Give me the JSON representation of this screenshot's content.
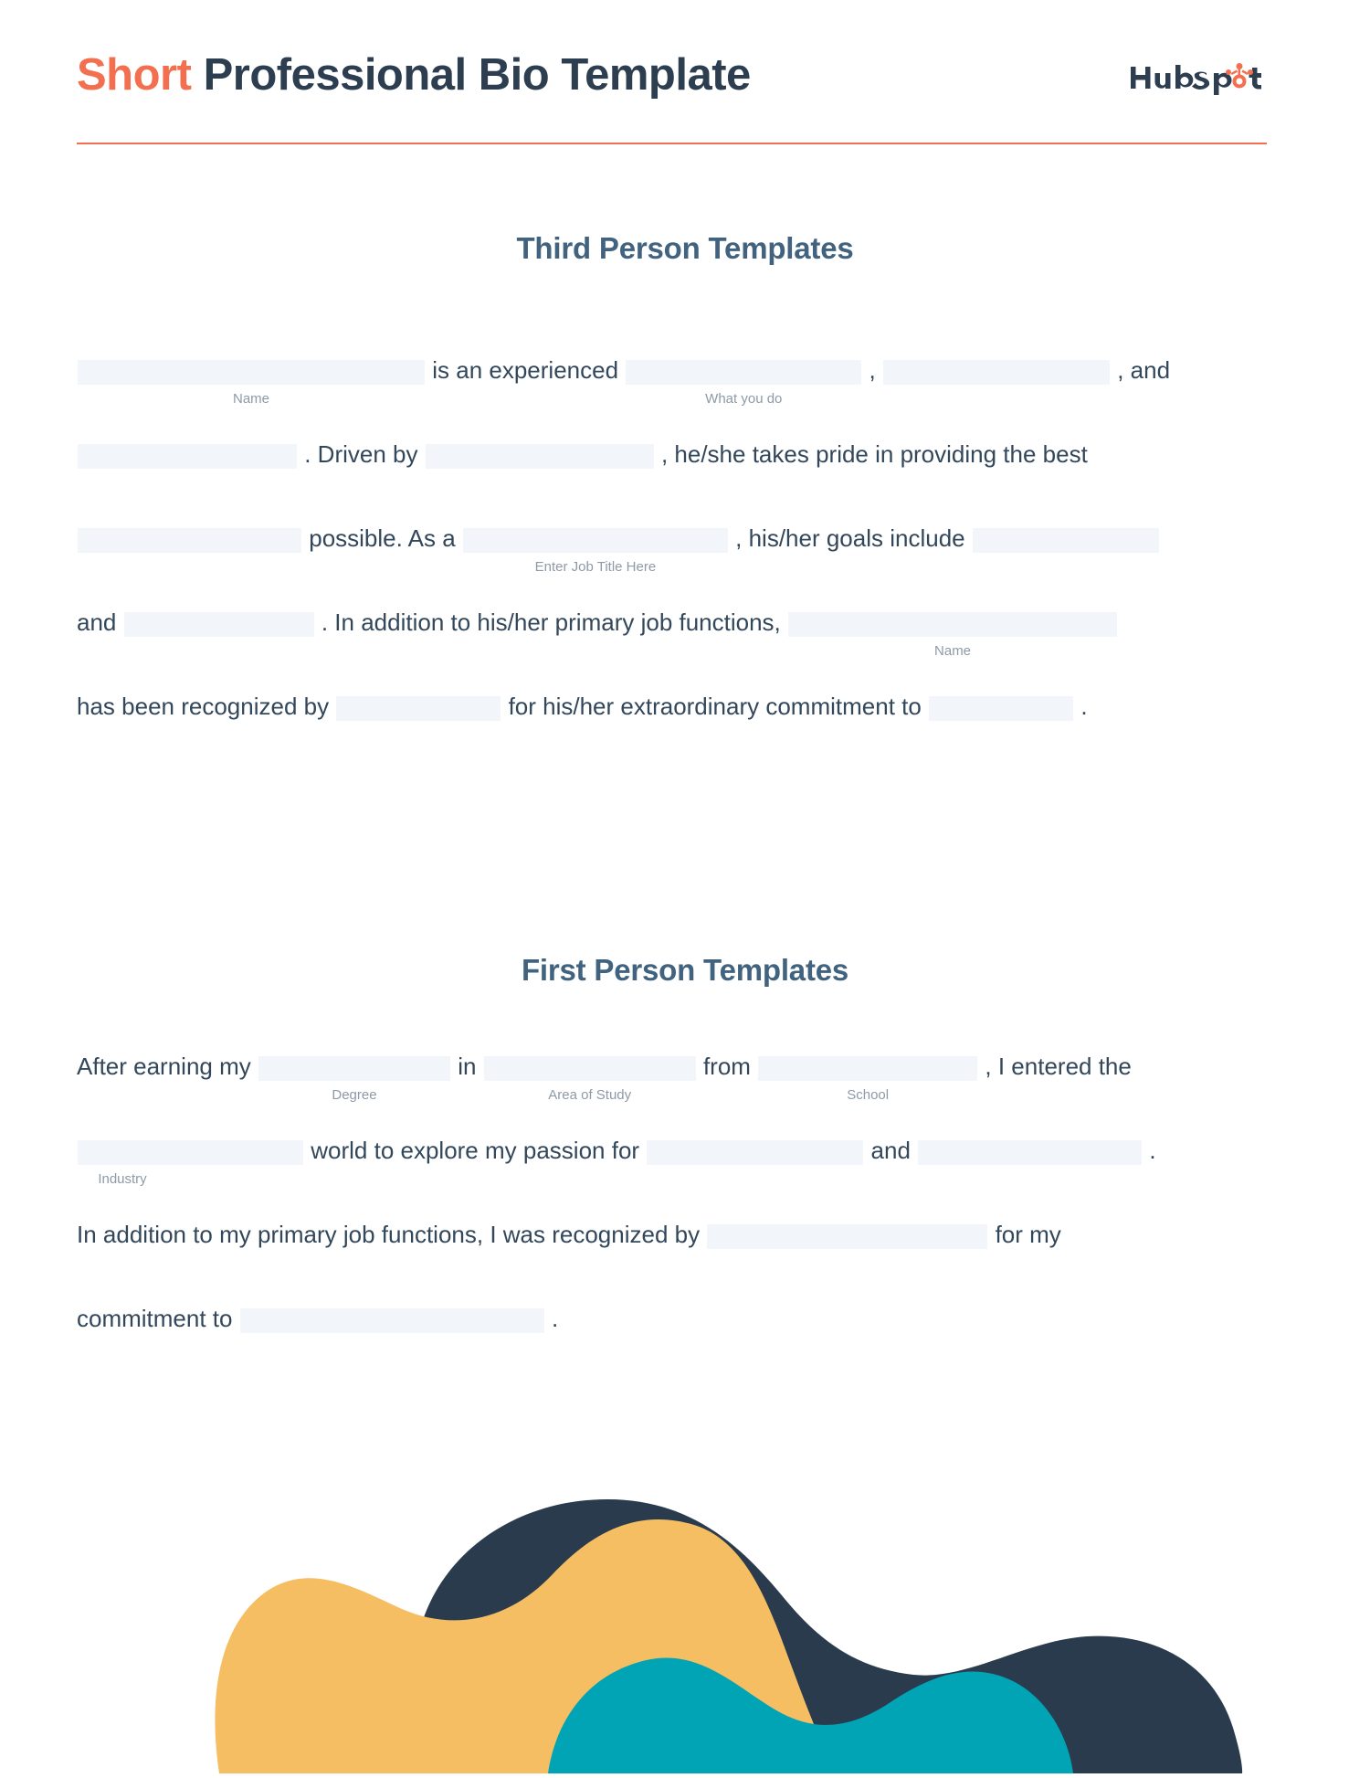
{
  "document": {
    "title_accent": "Short",
    "title_rest": "Professional Bio Template",
    "brand_logo_name": "HubSpot",
    "colors": {
      "accent_orange": "#f2704f",
      "navy": "#2d3e50",
      "heading_blue": "#41637f",
      "body_text": "#33475b",
      "blank_fill": "#f2f5f9",
      "label_gray": "#8d9aa8",
      "blob_navy": "#2a3b4d",
      "blob_yellow": "#f5be63",
      "blob_teal": "#00a4b4"
    }
  },
  "sections": [
    {
      "id": "third",
      "heading": "Third Person Templates"
    },
    {
      "id": "first",
      "heading": "First Person Templates"
    }
  ],
  "third_person": {
    "line1": {
      "blank1_label": "Name",
      "text1": "is an experienced",
      "blank2_label": "What you do",
      "text2": ",",
      "text3": ", and"
    },
    "line2": {
      "text1": ". Driven by",
      "text2": ", he/she takes pride in providing the best"
    },
    "line3": {
      "text1": "possible. As a",
      "blank_label": "Enter Job Title Here",
      "text2": ", his/her goals include"
    },
    "line4": {
      "text1": "and",
      "text2": ". In addition to his/her primary job functions,",
      "blank_label": "Name"
    },
    "line5": {
      "text1": "has been recognized by",
      "text2": "for his/her extraordinary commitment to",
      "text3": "."
    }
  },
  "first_person": {
    "line1": {
      "text1": "After earning my",
      "blank1_label": "Degree",
      "text2": "in",
      "blank2_label": "Area of Study",
      "text3": "from",
      "blank3_label": "School",
      "text4": ", I entered the"
    },
    "line2": {
      "blank_label": "Industry",
      "text1": "world to explore my passion for",
      "text2": "and",
      "text3": "."
    },
    "line3": {
      "text1": "In addition to my primary job functions, I was recognized by",
      "text2": "for my"
    },
    "line4": {
      "text1": "commitment to",
      "text2": "."
    }
  },
  "blanks": {
    "placeholder": ""
  },
  "decoration": {
    "blob_navy_name": "navy-blob",
    "blob_yellow_name": "yellow-blob",
    "blob_teal_name": "teal-blob"
  }
}
